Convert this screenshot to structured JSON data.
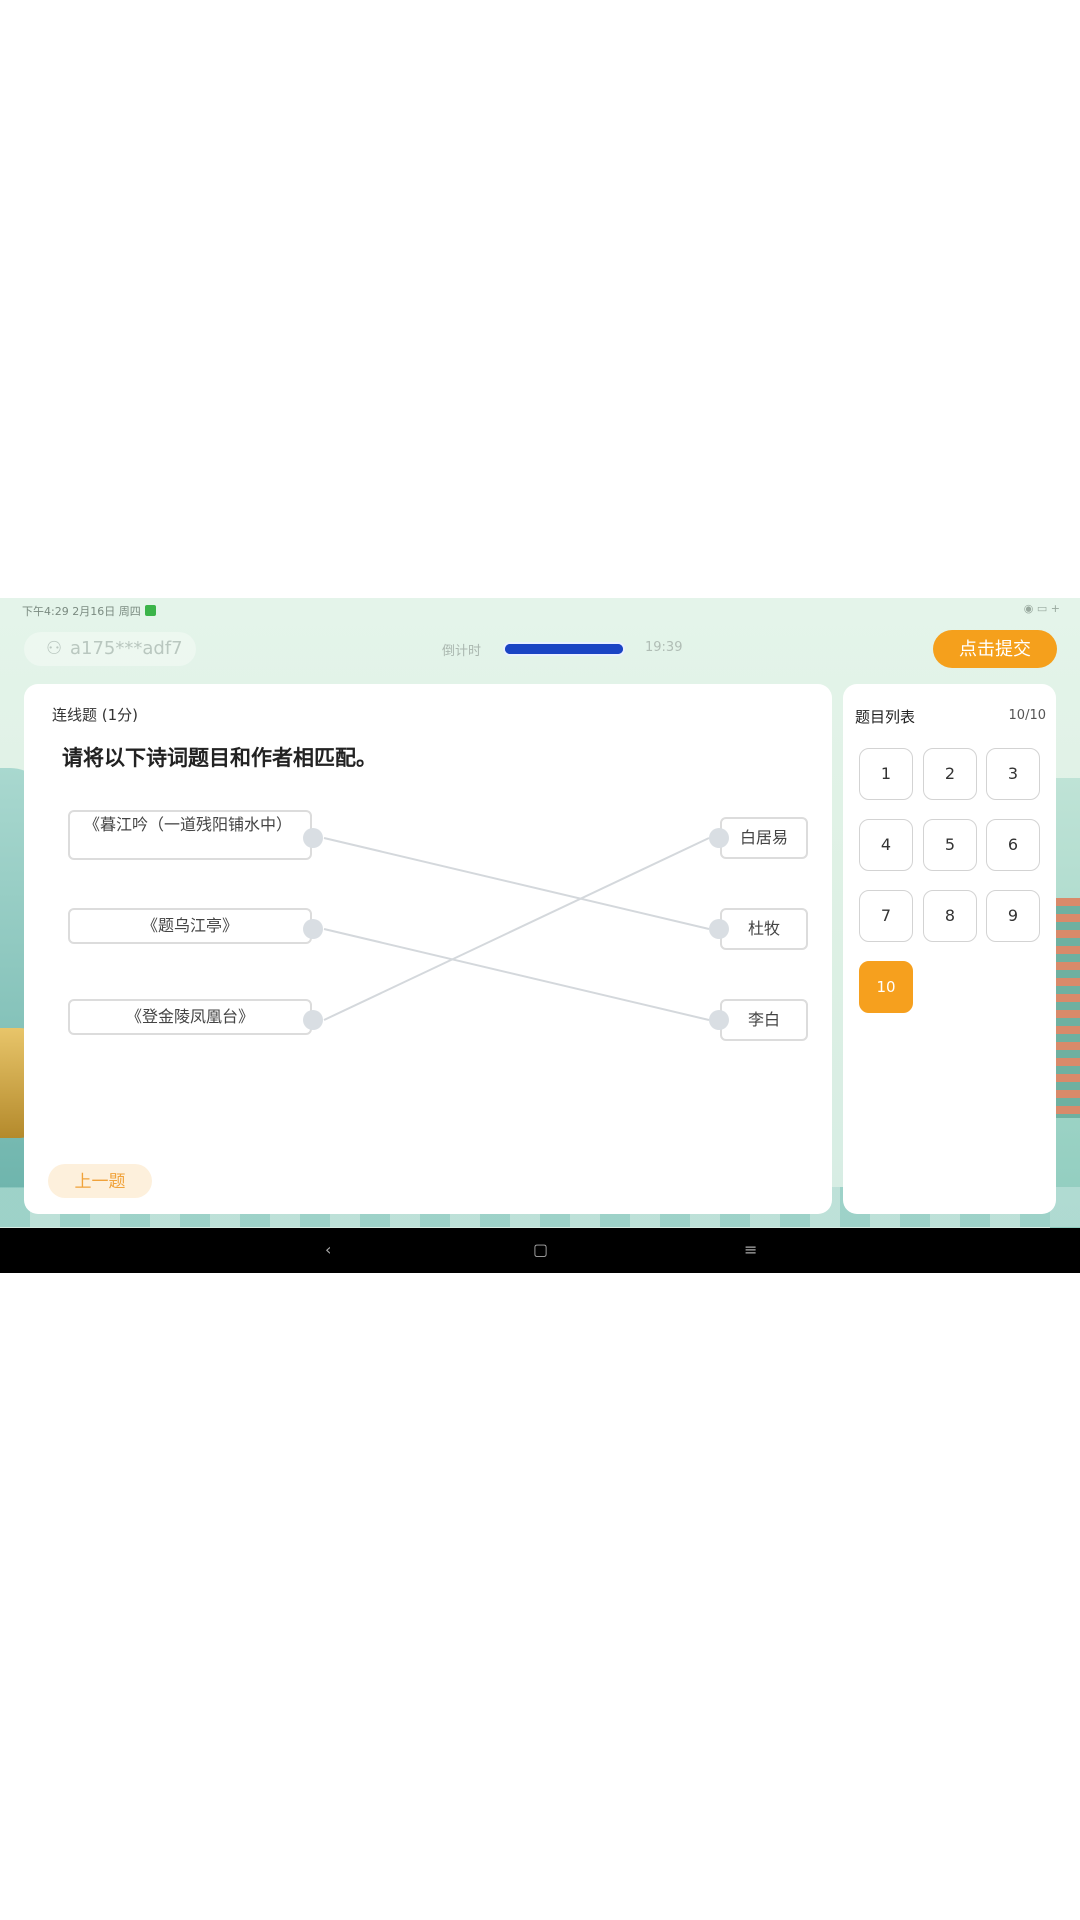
{
  "status_bar": {
    "time_date": "下午4:29  2月16日  周四",
    "right": "◉ ▭ +"
  },
  "header": {
    "user_icon": "user-icon",
    "username": "a175***adf7",
    "timer_label": "倒计时",
    "timer_progress": 1.0,
    "timer_value": "19:39",
    "submit_label": "点击提交"
  },
  "question": {
    "type_label": "连线题   (1分)",
    "prompt": "请将以下诗词题目和作者相匹配。",
    "left_items": [
      "《暮江吟（一道残阳铺水中）",
      "《题乌江亭》",
      "《登金陵凤凰台》"
    ],
    "right_items": [
      "白居易",
      "杜牧",
      "李白"
    ],
    "connections": [
      [
        0,
        1
      ],
      [
        1,
        2
      ],
      [
        2,
        0
      ]
    ],
    "prev_label": "上一题"
  },
  "question_list": {
    "title": "题目列表",
    "count": "10/10",
    "items": [
      "1",
      "2",
      "3",
      "4",
      "5",
      "6",
      "7",
      "8",
      "9",
      "10"
    ],
    "active_index": 9
  },
  "nav_bar": {
    "back": "‹",
    "home": "▢",
    "menu": "≡"
  },
  "colors": {
    "accent": "#f5a01c",
    "timer": "#1a44c4"
  }
}
